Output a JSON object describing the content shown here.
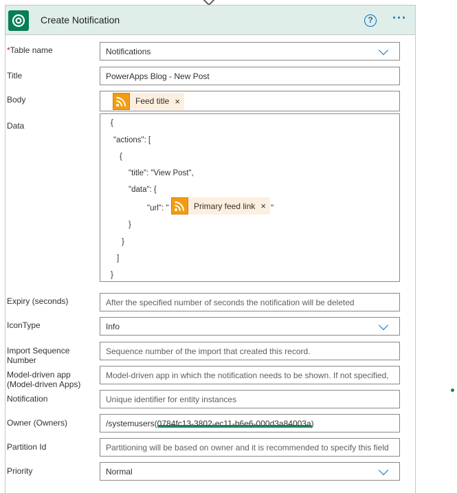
{
  "header": {
    "title": "Create Notification",
    "help": "?",
    "more": "···"
  },
  "fields": {
    "table_name": {
      "label": "Table name",
      "required_mark": "*",
      "value": "Notifications"
    },
    "title": {
      "label": "Title",
      "value": "PowerApps Blog - New Post"
    },
    "body": {
      "label": "Body",
      "token": "Feed title",
      "token_remove": "×"
    },
    "data": {
      "label": "Data",
      "lines": [
        "{",
        "\"actions\": [",
        "{",
        "\"title\": \"View Post\",",
        "\"data\": {",
        "\"url\": \"",
        "\"",
        "}",
        "}",
        "]",
        "}"
      ],
      "token": "Primary feed link",
      "token_remove": "×"
    },
    "expiry": {
      "label": "Expiry (seconds)",
      "placeholder": "After the specified number of seconds the notification will be deleted"
    },
    "icon_type": {
      "label": "IconType",
      "value": "Info"
    },
    "import_seq": {
      "label_line1": "Import Sequence",
      "label_line2": "Number",
      "placeholder": "Sequence number of the import that created this record."
    },
    "model_app": {
      "label_line1": "Model-driven app",
      "label_line2": "(Model-driven Apps)",
      "placeholder": "Model-driven app in which the notification needs to be shown. If not specified,"
    },
    "notification": {
      "label": "Notification",
      "placeholder": "Unique identifier for entity instances"
    },
    "owner": {
      "label": "Owner (Owners)",
      "value": "/systemusers(0784fc13-3802-ec11-b6e6-000d3a84003a)"
    },
    "partition": {
      "label": "Partition Id",
      "placeholder": "Partitioning will be based on owner and it is recommended to specify this field"
    },
    "priority": {
      "label": "Priority",
      "value": "Normal"
    }
  },
  "colors": {
    "header_bg": "#dfeee8",
    "accent": "#0f6cbd",
    "brand": "#087e55",
    "token_bg": "#fdefdf",
    "rss": "#f39c12"
  }
}
